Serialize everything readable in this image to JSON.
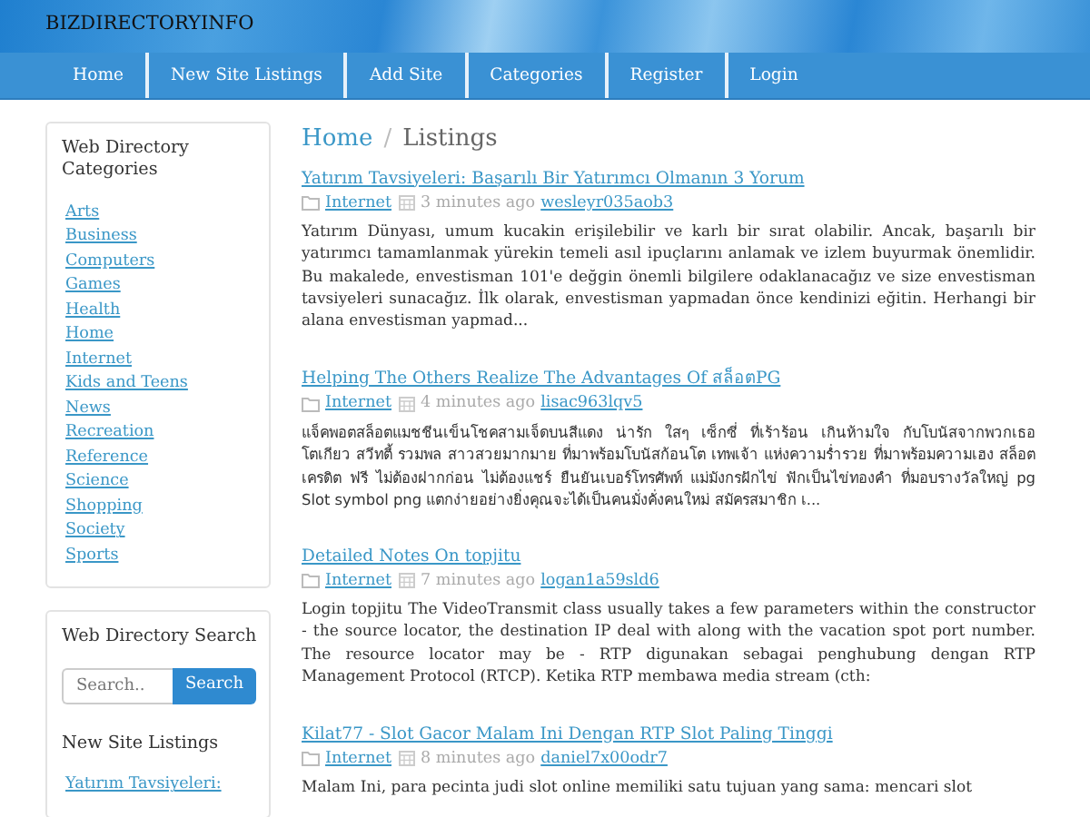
{
  "site_title": "BIZDIRECTORYINFO",
  "nav": [
    {
      "label": "Home"
    },
    {
      "label": "New Site Listings"
    },
    {
      "label": "Add Site"
    },
    {
      "label": "Categories"
    },
    {
      "label": "Register"
    },
    {
      "label": "Login"
    }
  ],
  "sidebar": {
    "categories_title": "Web Directory Categories",
    "categories": [
      "Arts",
      "Business",
      "Computers",
      "Games",
      "Health",
      "Home",
      "Internet",
      "Kids and Teens",
      "News",
      "Recreation",
      "Reference",
      "Science",
      "Shopping",
      "Society",
      "Sports"
    ],
    "search_title": "Web Directory Search",
    "search": {
      "placeholder": "Search..",
      "button": "Search"
    },
    "new_listings_title": "New Site Listings",
    "new_listings": [
      "Yatırım Tavsiyeleri:"
    ]
  },
  "breadcrumb_separator": "/",
  "breadcrumb": [
    {
      "label": "Home"
    },
    {
      "label": "Listings"
    }
  ],
  "posts": [
    {
      "title": "Yatırım Tavsiyeleri: Başarılı Bir Yatırımcı Olmanın 3 Yorum",
      "category": "Internet",
      "time": "3 minutes ago",
      "author": "wesleyr035aob3",
      "body": "Yatırım Dünyası, umum kucakin erişilebilir ve karlı bir sırat olabilir. Ancak, başarılı bir yatırımcı tamamlanmak yürekin temeli asıl ipuçlarını anlamak ve izlem buyurmak önemlidir. Bu makalede, envestisman 101'e değgin önemli bilgilere odaklanacağız ve size envestisman tavsiyeleri sunacağız. İlk olarak, envestisman yapmadan önce kendinizi eğitin. Herhangi bir alana envestisman yapmad..."
    },
    {
      "title": "Helping The Others Realize The Advantages Of สล็อตPG",
      "category": "Internet",
      "time": "4 minutes ago",
      "author": "lisac963lqv5",
      "body": "แจ็คพอตสล็อตแมชชีนเข็นโชคสามเจ็ดบนสีแดง น่ารัก ใสๆ เซ็กซี่ ที่เร้าร้อน เกินห้ามใจ กับโบนัสจากพวกเธอ โตเกียว สวีทตี้ รวมพล สาวสวยมากมาย ที่มาพร้อมโบนัสก้อนโต เทพเจ้า แห่งความร่ำรวย ที่มาพร้อมความเฮง สล็อต เครดิต ฟรี ไม่ต้องฝากก่อน ไม่ต้องแชร์ ยืนยันเบอร์โทรศัพท์ แม่มังกรฝักไข่ ฟักเป็นไข่ทองคำ ที่มอบรางวัลใหญ่ pg Slot symbol png แตกง่ายอย่างยิ่งคุณจะได้เป็นคนมั่งคั่งคนใหม่ สมัครสมาชิก เ..."
    },
    {
      "title": "Detailed Notes On topjitu",
      "category": "Internet",
      "time": "7 minutes ago",
      "author": "logan1a59sld6",
      "body": "Login topjitu The VideoTransmit class usually takes a few parameters within the constructor - the source locator, the destination IP deal with along with the vacation spot port number. The resource locator may be - RTP digunakan sebagai penghubung dengan RTP Management Protocol (RTCP). Ketika RTP membawa media stream (cth:"
    },
    {
      "title": "Kilat77 - Slot Gacor Malam Ini Dengan RTP Slot Paling Tinggi",
      "category": "Internet",
      "time": "8 minutes ago",
      "author": "daniel7x00odr7",
      "body": "Malam Ini, para pecinta judi slot online memiliki satu tujuan yang sama: mencari slot"
    }
  ]
}
